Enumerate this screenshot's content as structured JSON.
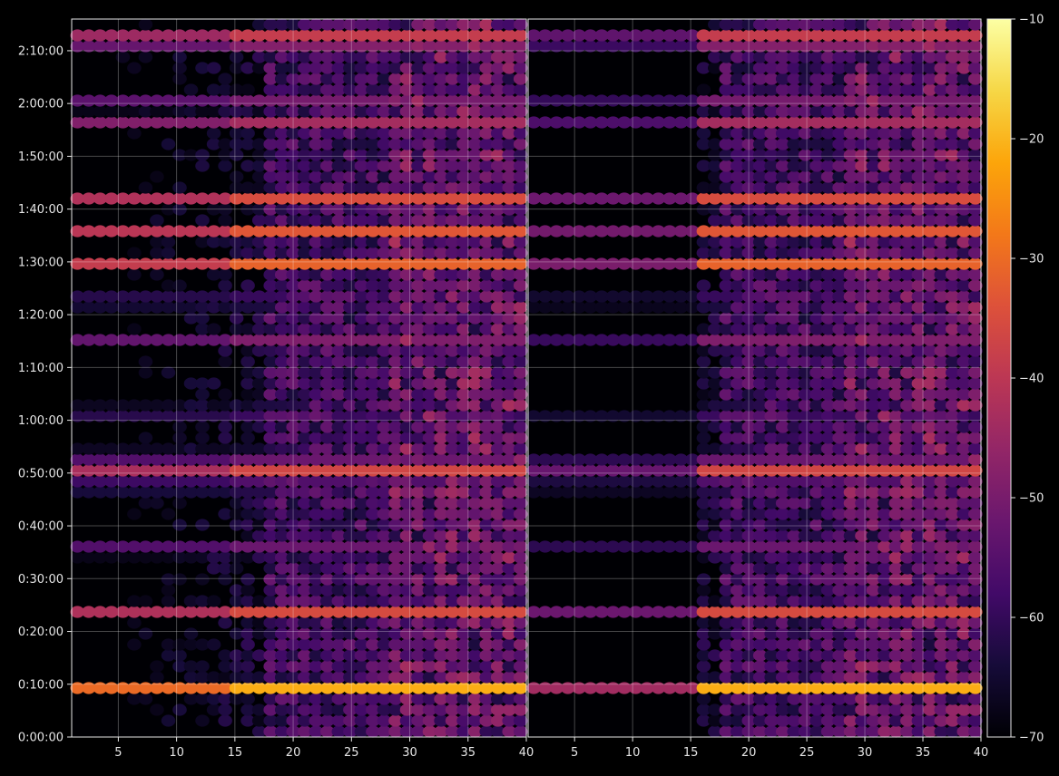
{
  "chart_data": {
    "type": "heatmap",
    "colormap": "inferno",
    "background": "#000000",
    "title": "",
    "grid": true,
    "panels": [
      {
        "name": "",
        "xlim": [
          1,
          40
        ],
        "ylim_seconds": [
          0,
          8160
        ]
      },
      {
        "name": "",
        "xlim": [
          1,
          40
        ],
        "ylim_seconds": [
          0,
          8160
        ]
      }
    ],
    "x_ticks": [
      "5",
      "10",
      "15",
      "20",
      "25",
      "30",
      "35",
      "40"
    ],
    "x_tick_values": [
      5,
      10,
      15,
      20,
      25,
      30,
      35,
      40
    ],
    "y_ticks": [
      "0:00:00",
      "0:10:00",
      "0:20:00",
      "0:30:00",
      "0:40:00",
      "0:50:00",
      "1:00:00",
      "1:10:00",
      "1:20:00",
      "1:30:00",
      "1:40:00",
      "1:50:00",
      "2:00:00",
      "2:10:00"
    ],
    "y_tick_seconds": [
      0,
      600,
      1200,
      1800,
      2400,
      3000,
      3600,
      4200,
      4800,
      5400,
      6000,
      6600,
      7200,
      7800
    ],
    "colorbar": {
      "min": -70,
      "max": -10,
      "ticks": [
        "−70",
        "−60",
        "−50",
        "−40",
        "−30",
        "−20",
        "−10"
      ],
      "tick_values": [
        -70,
        -60,
        -50,
        -40,
        -30,
        -20,
        -10
      ]
    },
    "bands": [
      {
        "t_sec": 570,
        "level": -18
      },
      {
        "t_sec": 1390,
        "level": -22
      },
      {
        "t_sec": 2120,
        "level": -36
      },
      {
        "t_sec": 2850,
        "level": -30
      },
      {
        "t_sec": 2990,
        "level": -15
      },
      {
        "t_sec": 3200,
        "level": -32
      },
      {
        "t_sec": 3700,
        "level": -42
      },
      {
        "t_sec": 4480,
        "level": -40
      },
      {
        "t_sec": 4950,
        "level": -38
      },
      {
        "t_sec": 5350,
        "level": -20
      },
      {
        "t_sec": 5780,
        "level": -20
      },
      {
        "t_sec": 6130,
        "level": -34
      },
      {
        "t_sec": 6950,
        "level": -30
      },
      {
        "t_sec": 7190,
        "level": -34
      },
      {
        "t_sec": 7890,
        "level": -34
      },
      {
        "t_sec": 7990,
        "level": -36
      }
    ]
  }
}
